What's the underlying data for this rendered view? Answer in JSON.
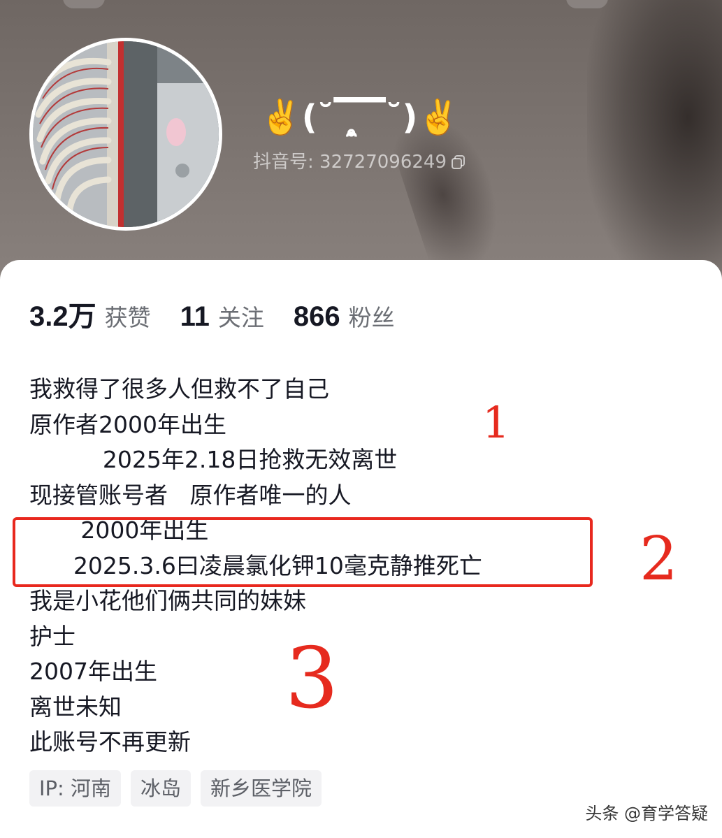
{
  "profile": {
    "nickname_left_emoji": "✌️",
    "nickname_text": "(˘▔̥̯▔˘)",
    "nickname_right_emoji": "✌️",
    "douyin_id_label": "抖音号: 32727096249"
  },
  "stats": [
    {
      "value": "3.2万",
      "label": "获赞"
    },
    {
      "value": "11",
      "label": "关注"
    },
    {
      "value": "866",
      "label": "粉丝"
    }
  ],
  "bio": [
    "我救得了很多人但救不了自己",
    "原作者2000年出生",
    "          2025年2.18日抢救无效离世",
    "现接管账号者   原作者唯一的人",
    "       2000年出生",
    "      2025.3.6曰凌晨氯化钾10毫克静推死亡",
    "我是小花他们俩共同的妹妹",
    "护士",
    "2007年出生",
    "离世未知",
    "此账号不再更新"
  ],
  "annotations": {
    "one": "1",
    "two": "2",
    "three": "3",
    "highlight_color": "#e8281e"
  },
  "tags": [
    "IP: 河南",
    "冰岛",
    "新乡医学院"
  ],
  "watermark": "头条 @育学答疑",
  "icons": {
    "copy": "copy-icon",
    "avatar": "avatar-image"
  }
}
